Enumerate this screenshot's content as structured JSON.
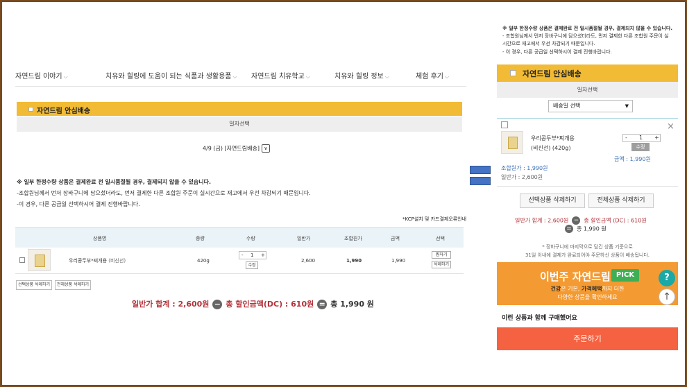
{
  "nav": {
    "items": [
      "자연드림 이야기",
      "치유와 힐링에 도움이 되는 식품과 생활용품",
      "자연드림 치유학교",
      "치유와 힐링 정보",
      "체험 후기"
    ]
  },
  "left": {
    "banner_title": "자연드림 안심배송",
    "day_select_label": "일자선택",
    "delivery_select_value": "4/9 (금) [자연드림배송]",
    "notice_lines": [
      "※ 일부 한정수량 상품은 결제완료 전 일시품절될 경우, 결제되지 않을 수 있습니다.",
      "-조합원님께서 먼저 장바구니에 담으셨더라도, 먼저 결제한 다른 조합원 주문이 실시간으로 재고에서 우선 차감되기 때문입니다.",
      "-이 경우, 다른 공급일 선택하시어 결제 진행바랍니다."
    ],
    "kcp_text": "*KCP설치 및 카드결제오류안내",
    "table": {
      "headers": [
        "상품명",
        "중량",
        "수량",
        "일반가",
        "조합원가",
        "금액",
        "선택"
      ],
      "row": {
        "name": "우리콩두부*찌개용",
        "tag": "(비신선)",
        "weight": "420g",
        "qty": "1",
        "qty_apply": "수정",
        "normal_price": "2,600",
        "member_price": "1,990",
        "amount": "1,990",
        "actions": [
          "찜하기",
          "삭제하기"
        ]
      }
    },
    "bottom_buttons": [
      "선택상품 삭제하기",
      "전체상품 삭제하기"
    ],
    "summary": {
      "normal_total": "일반가 합계 : 2,600원",
      "discount_total": "총 할인금액(DC) : 610원",
      "final_total": "총 1,990 원"
    }
  },
  "right": {
    "notice_lines": [
      "※ 일부 한정수량 상품은 결제완료 전 일시품절될 경우, 결제되지 않을 수 있습니다.",
      "- 조합원님께서 먼저 장바구니에 담으셨더라도, 먼저 결제한 다른 조합원 주문이 실",
      "시간으로 재고에서 우선 차감되기 때문입니다.",
      "- 이 경우, 다른 공급일 선택하시어 결제 진행바랍니다."
    ],
    "banner_title": "자연드림 안심배송",
    "day_select_label": "일자선택",
    "delivery_select_placeholder": "배송일 선택",
    "cart_item": {
      "name": "우리콩두부*찌개용",
      "sub": "(비신선) (420g)",
      "qty": "1",
      "qty_apply": "수정",
      "amount": "금액 : 1,990원",
      "member_price": "조합원가 : 1,990원",
      "normal_price": "일반가 : 2,600원"
    },
    "buttons": [
      "선택상품 삭제하기",
      "전체상품 삭제하기"
    ],
    "summary": {
      "normal_total": "일반가 합계 : 2,600원",
      "discount_total": "총 할인금액 (DC) : 610원",
      "final_total": "총 1,990 원"
    },
    "cart_note": [
      "* 장바구니에 마지막으로 담긴 상품 기준으로",
      "31일 이내에 결제가 완료되어야 주문하신 상품이 배송됩니다."
    ],
    "pick": {
      "heading": "이번주 자연드림",
      "badge": "PICK",
      "line1_a": "건강",
      "line1_b": "은 기본, ",
      "line1_c": "가격혜택",
      "line1_d": "까지 더한",
      "line2": "다양한 상품을 확인하세요"
    },
    "also_bought": "이런 상품과 함께 구매했어요",
    "order_button": "주문하기"
  },
  "colors": {
    "banner": "#f1bb35",
    "order": "#f46242",
    "pick": "#f39a32",
    "pick_badge": "#3fae55",
    "price_red": "#b2333a",
    "member_blue": "#3b6fb6"
  }
}
